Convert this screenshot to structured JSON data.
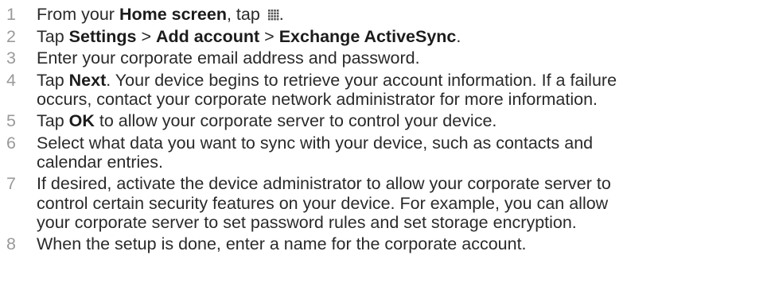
{
  "steps": [
    {
      "number": "1",
      "parts": [
        {
          "t": "From your "
        },
        {
          "t": "Home screen",
          "b": true
        },
        {
          "t": ", tap "
        },
        {
          "icon": "apps-grid-icon"
        },
        {
          "t": "."
        }
      ]
    },
    {
      "number": "2",
      "parts": [
        {
          "t": "Tap "
        },
        {
          "t": "Settings",
          "b": true
        },
        {
          "t": " > "
        },
        {
          "t": "Add account",
          "b": true
        },
        {
          "t": " > "
        },
        {
          "t": "Exchange ActiveSync",
          "b": true
        },
        {
          "t": "."
        }
      ]
    },
    {
      "number": "3",
      "parts": [
        {
          "t": "Enter your corporate email address and password."
        }
      ]
    },
    {
      "number": "4",
      "parts": [
        {
          "t": "Tap "
        },
        {
          "t": "Next",
          "b": true
        },
        {
          "t": ". Your device begins to retrieve your account information. If a failure"
        },
        {
          "br": true
        },
        {
          "t": "occurs, contact your corporate network administrator for more information."
        }
      ]
    },
    {
      "number": "5",
      "parts": [
        {
          "t": "Tap "
        },
        {
          "t": "OK",
          "b": true
        },
        {
          "t": " to allow your corporate server to control your device."
        }
      ]
    },
    {
      "number": "6",
      "parts": [
        {
          "t": "Select what data you want to sync with your device, such as contacts and"
        },
        {
          "br": true
        },
        {
          "t": "calendar entries."
        }
      ]
    },
    {
      "number": "7",
      "parts": [
        {
          "t": "If desired, activate the device administrator to allow your corporate server to"
        },
        {
          "br": true
        },
        {
          "t": "control certain security features on your device. For example, you can allow"
        },
        {
          "br": true
        },
        {
          "t": "your corporate server to set password rules and set storage encryption."
        }
      ]
    },
    {
      "number": "8",
      "parts": [
        {
          "t": "When the setup is done, enter a name for the corporate account."
        }
      ]
    }
  ]
}
